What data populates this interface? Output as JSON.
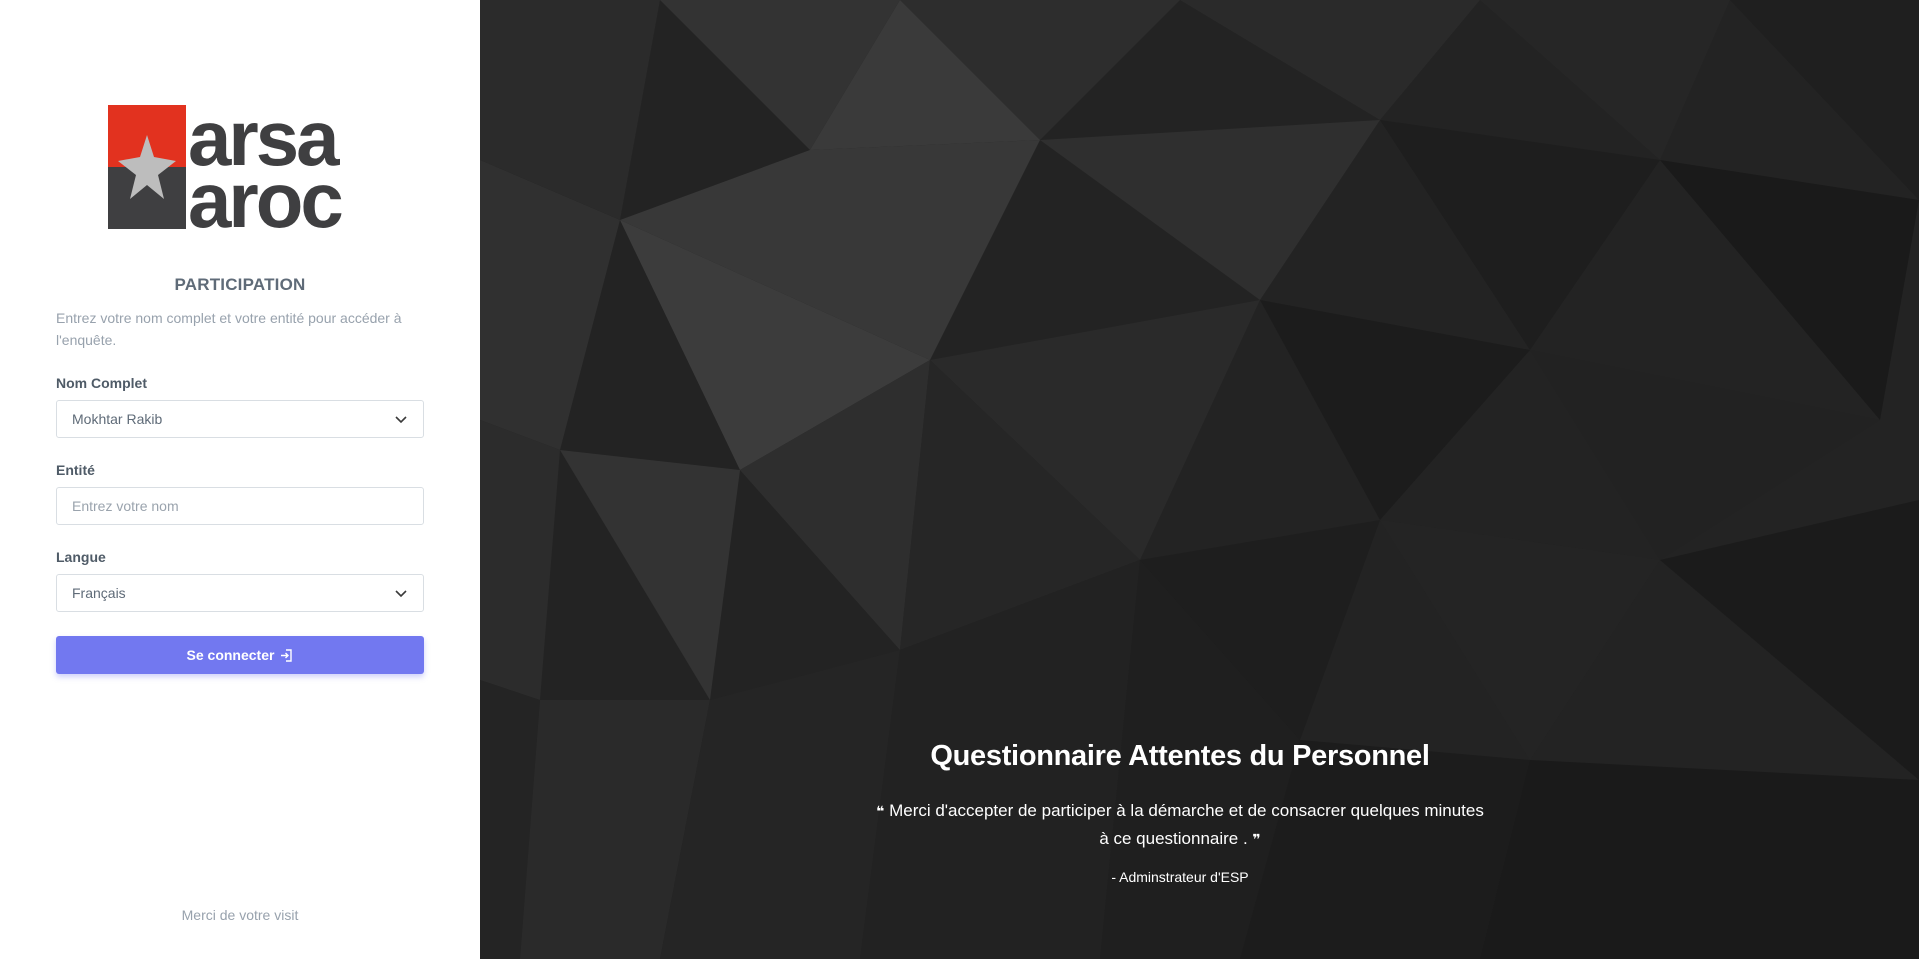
{
  "logo": {
    "line1": "Marsa",
    "line2": "Maroc",
    "colors": {
      "red": "#e2321f",
      "dark": "#3f3f41",
      "star": "#bdbdbd"
    }
  },
  "form": {
    "title": "PARTICIPATION",
    "subtitle": "Entrez votre nom complet et votre entité pour accéder à l'enquête.",
    "fields": {
      "name": {
        "label": "Nom Complet",
        "value": "Mokhtar Rakib"
      },
      "entity": {
        "label": "Entité",
        "placeholder": "Entrez votre nom"
      },
      "language": {
        "label": "Langue",
        "value": "Français"
      }
    },
    "submit_label": "Se connecter",
    "submit_color": "#7278f0"
  },
  "footer": {
    "text": "Merci de votre visit"
  },
  "hero": {
    "title": "Questionnaire Attentes du Personnel",
    "quote": "Merci d'accepter de participer à la démarche et de consacrer quelques minutes à ce questionnaire .",
    "author": "- Adminstrateur d'ESP"
  }
}
